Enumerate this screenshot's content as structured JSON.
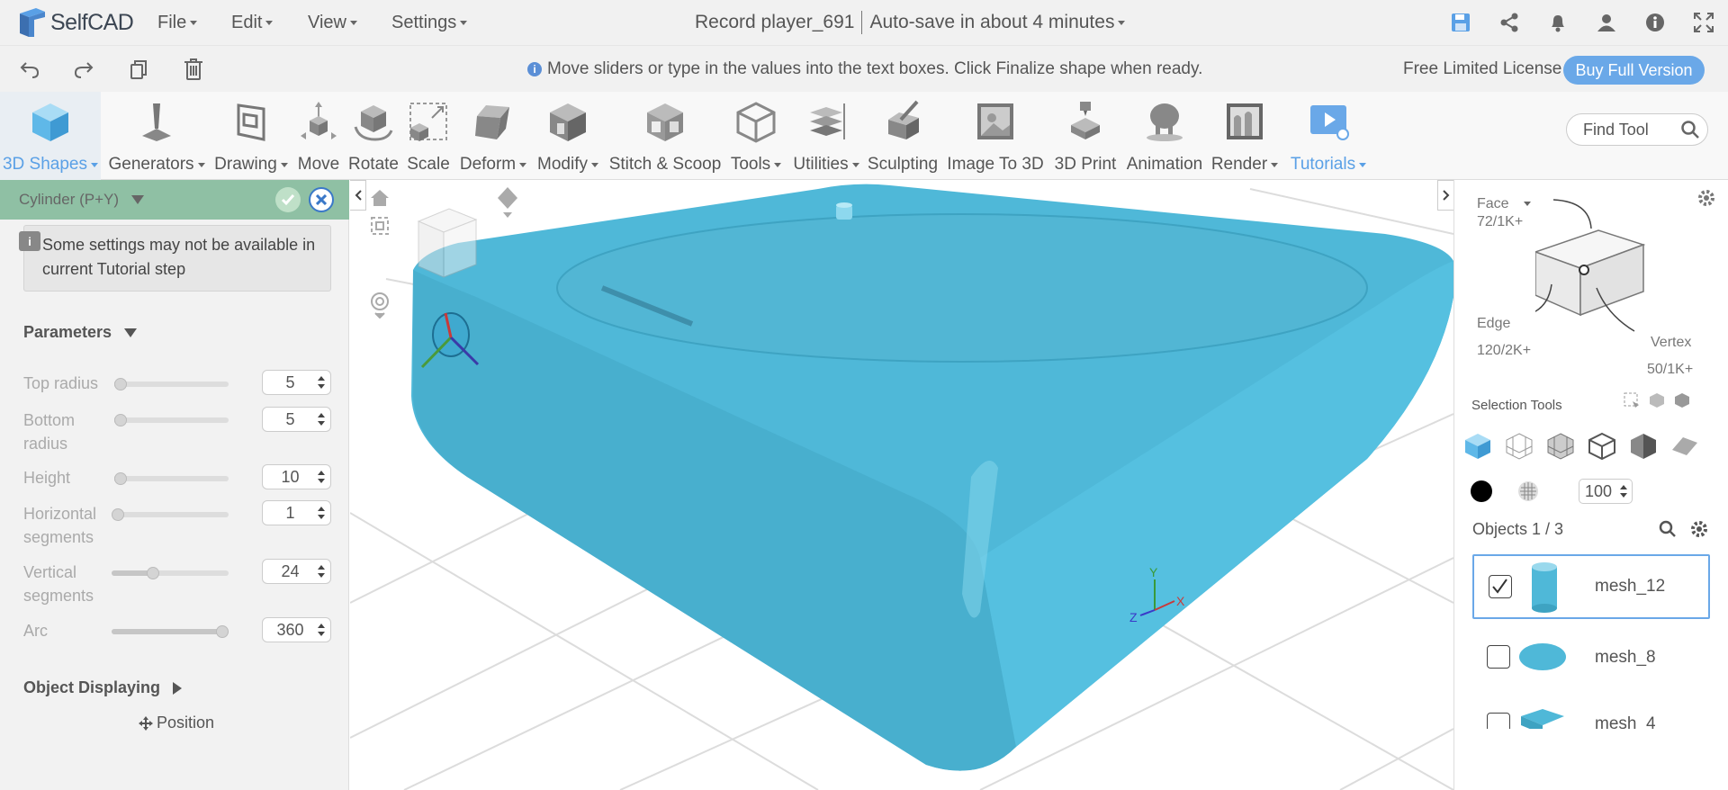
{
  "app": {
    "logo": "SelfCAD",
    "project_name": "Record player_691",
    "autosave": "Auto-save in about 4 minutes"
  },
  "menu": {
    "file": "File",
    "edit": "Edit",
    "view": "View",
    "settings": "Settings"
  },
  "topbar_icons": [
    "save-icon",
    "share-icon",
    "bell-icon",
    "user-icon",
    "info-icon",
    "fullscreen-icon"
  ],
  "secondbar": {
    "hint": "Move sliders or type in the values into the text boxes. Click Finalize shape when ready.",
    "license": "Free Limited License",
    "buy": "Buy Full Version"
  },
  "toolbar": {
    "shapes": "3D Shapes",
    "generators": "Generators",
    "drawing": "Drawing",
    "move": "Move",
    "rotate": "Rotate",
    "scale": "Scale",
    "deform": "Deform",
    "modify": "Modify",
    "stitch": "Stitch & Scoop",
    "tools": "Tools",
    "utilities": "Utilities",
    "sculpting": "Sculpting",
    "image3d": "Image To 3D",
    "print": "3D Print",
    "animation": "Animation",
    "render": "Render",
    "tutorials": "Tutorials",
    "find_placeholder": "Find Tool"
  },
  "panel": {
    "title": "Cylinder (P+Y)",
    "note": "Some settings may not be available in current Tutorial step",
    "parameters_label": "Parameters",
    "params": [
      {
        "label": "Top radius",
        "value": "5",
        "fraction": 0.02
      },
      {
        "label": "Bottom radius",
        "value": "5",
        "fraction": 0.02
      },
      {
        "label": "Height",
        "value": "10",
        "fraction": 0.02
      },
      {
        "label": "Horizontal segments",
        "value": "1",
        "fraction": 0.0
      },
      {
        "label": "Vertical segments",
        "value": "24",
        "fraction": 0.35
      },
      {
        "label": "Arc",
        "value": "360",
        "fraction": 1.0
      }
    ],
    "object_displaying": "Object Displaying",
    "position": "Position"
  },
  "viewport": {
    "axis_x": "X",
    "axis_y": "Y",
    "axis_z": "Z",
    "mesh_color": "#4fb8d8"
  },
  "right": {
    "face": "Face",
    "face_count": "72/1K+",
    "edge": "Edge",
    "edge_count": "120/2K+",
    "vertex": "Vertex",
    "vertex_count": "50/1K+",
    "selection_tools": "Selection Tools",
    "opacity": "100",
    "objects_label": "Objects 1 / 3",
    "objects": [
      {
        "name": "mesh_12",
        "checked": true
      },
      {
        "name": "mesh_8",
        "checked": false
      },
      {
        "name": "mesh_4",
        "checked": false
      }
    ]
  }
}
